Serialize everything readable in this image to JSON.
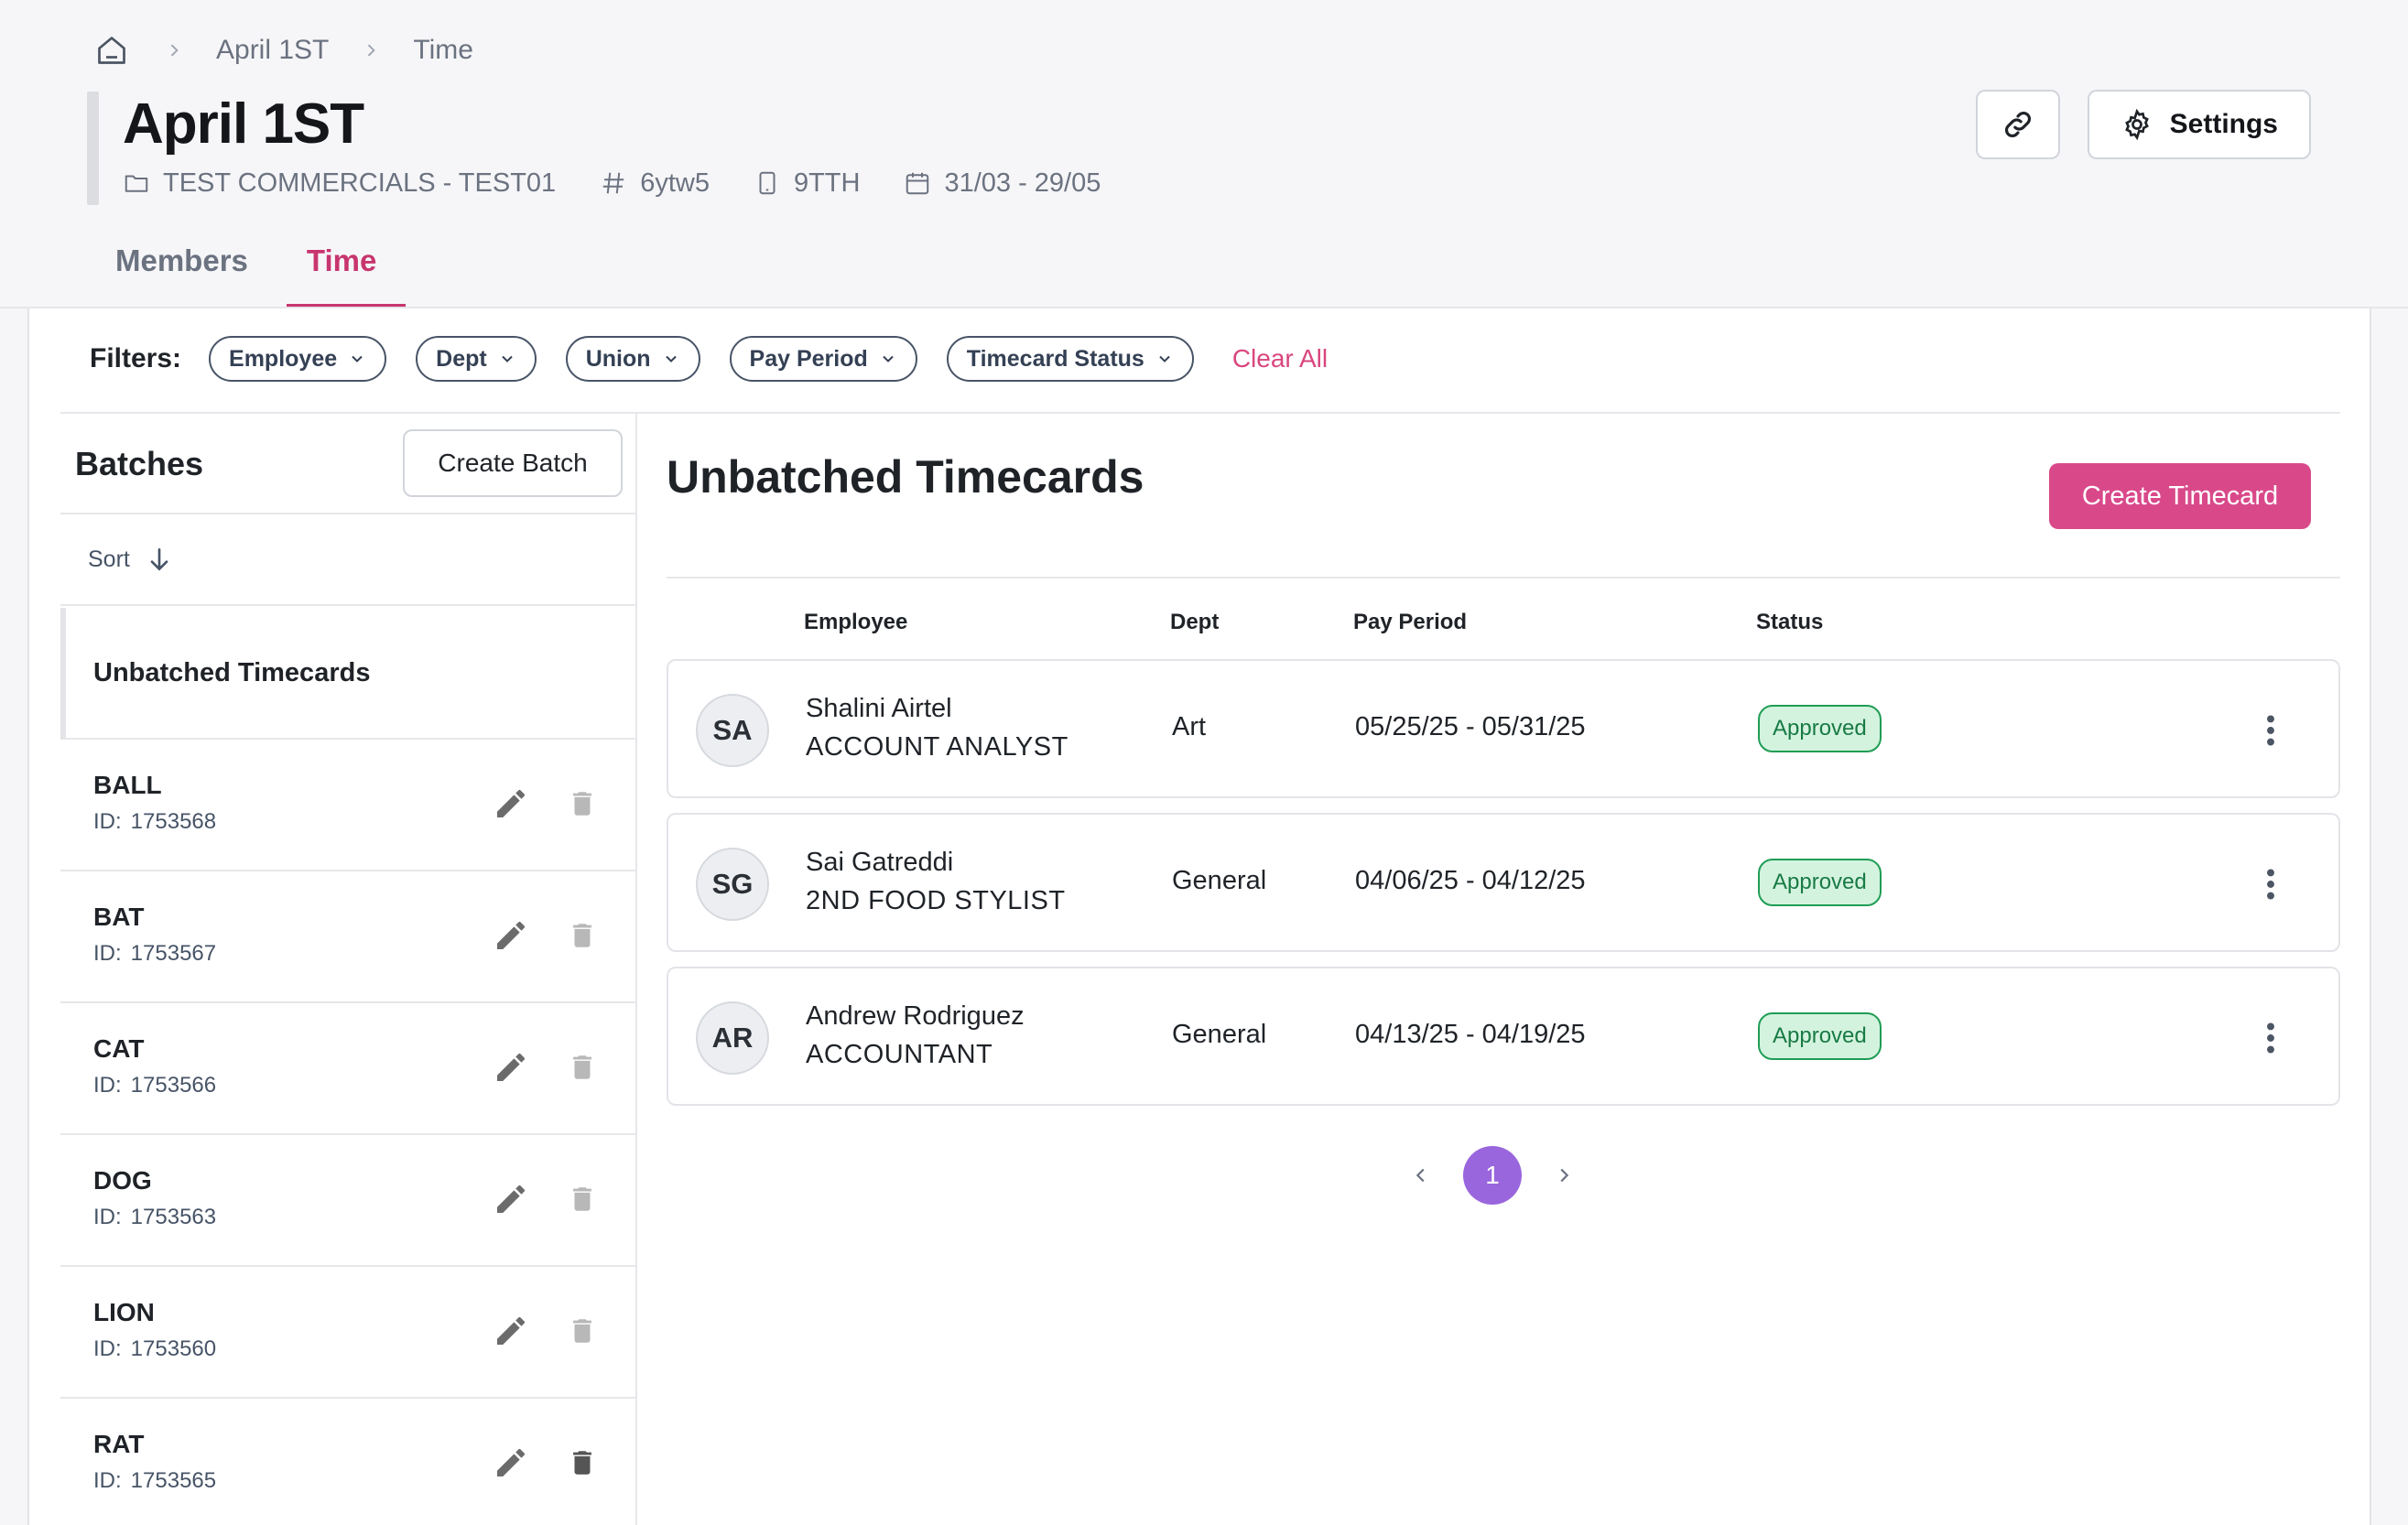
{
  "breadcrumb": {
    "items": [
      "April 1ST",
      "Time"
    ]
  },
  "page": {
    "title": "April 1ST",
    "meta": {
      "project": "TEST COMMERCIALS - TEST01",
      "code": "6ytw5",
      "device": "9TTH",
      "dates": "31/03 - 29/05"
    }
  },
  "header_actions": {
    "settings_label": "Settings"
  },
  "tabs": [
    {
      "label": "Members",
      "active": false
    },
    {
      "label": "Time",
      "active": true
    }
  ],
  "filters": {
    "label": "Filters:",
    "chips": [
      "Employee",
      "Dept",
      "Union",
      "Pay Period",
      "Timecard Status"
    ],
    "clear_label": "Clear All"
  },
  "batches": {
    "title": "Batches",
    "create_label": "Create Batch",
    "sort_label": "Sort",
    "unbatched_label": "Unbatched Timecards",
    "id_label": "ID:",
    "items": [
      {
        "name": "BALL",
        "id": "1753568"
      },
      {
        "name": "BAT",
        "id": "1753567"
      },
      {
        "name": "CAT",
        "id": "1753566"
      },
      {
        "name": "DOG",
        "id": "1753563"
      },
      {
        "name": "LION",
        "id": "1753560"
      },
      {
        "name": "RAT",
        "id": "1753565"
      }
    ]
  },
  "timecards": {
    "title": "Unbatched Timecards",
    "create_label": "Create Timecard",
    "columns": {
      "employee": "Employee",
      "dept": "Dept",
      "pay_period": "Pay Period",
      "status": "Status"
    },
    "rows": [
      {
        "initials": "SA",
        "name": "Shalini Airtel",
        "role": "ACCOUNT ANALYST",
        "dept": "Art",
        "pay_period": "05/25/25 - 05/31/25",
        "status": "Approved"
      },
      {
        "initials": "SG",
        "name": "Sai Gatreddi",
        "role": "2ND FOOD STYLIST",
        "dept": "General",
        "pay_period": "04/06/25 - 04/12/25",
        "status": "Approved"
      },
      {
        "initials": "AR",
        "name": "Andrew Rodriguez",
        "role": "ACCOUNTANT",
        "dept": "General",
        "pay_period": "04/13/25 - 04/19/25",
        "status": "Approved"
      }
    ]
  },
  "pagination": {
    "current_page": "1"
  },
  "colors": {
    "accent": "#c8356f",
    "primary_button": "#d9498a",
    "status_approved_bg": "#d4f3df",
    "status_approved_border": "#1f9d55",
    "pagination_active": "#9966dd"
  },
  "icons": {
    "home": "home-icon",
    "chevron_right": "chevron-right-icon",
    "folder": "folder-icon",
    "hash": "hash-icon",
    "device": "phone-icon",
    "calendar": "calendar-icon",
    "link": "link-icon",
    "settings": "gear-icon",
    "chevron_down": "chevron-down-icon",
    "sort": "arrow-down-icon",
    "edit": "pencil-icon",
    "delete": "trash-icon",
    "row_menu": "kebab-menu-icon"
  }
}
